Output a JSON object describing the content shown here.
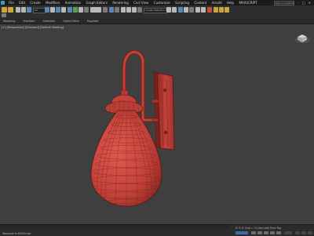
{
  "title_bar": {
    "menus": [
      "File",
      "Edit",
      "Create",
      "Modifiers",
      "Animation",
      "Graph Editors",
      "Rendering",
      "Civil View",
      "Customize",
      "Scripting",
      "Content",
      "Arnold",
      "Help",
      "MAXSCRIPT"
    ],
    "search_placeholder": "Type a keyword"
  },
  "toolbar": {
    "dropdown_1": "All",
    "dropdown_2": "Create Selection Se"
  },
  "ribbon": {
    "tabs": [
      "Modeling",
      "Freeform",
      "Selection",
      "Object Paint",
      "Populate"
    ]
  },
  "viewport": {
    "label": "[+] [Perspective] [Standard] [Default Shading]",
    "object": "wall-lamp-red-mesh",
    "colors": {
      "mesh": "#c2423a",
      "wire": "#6f1d18",
      "background": "#3f3f3f"
    }
  },
  "status_bar": {
    "left": "Welcome to MAXScript",
    "right": "X: Y: Z: Grid = 10.0cm   Add Time Tag"
  }
}
